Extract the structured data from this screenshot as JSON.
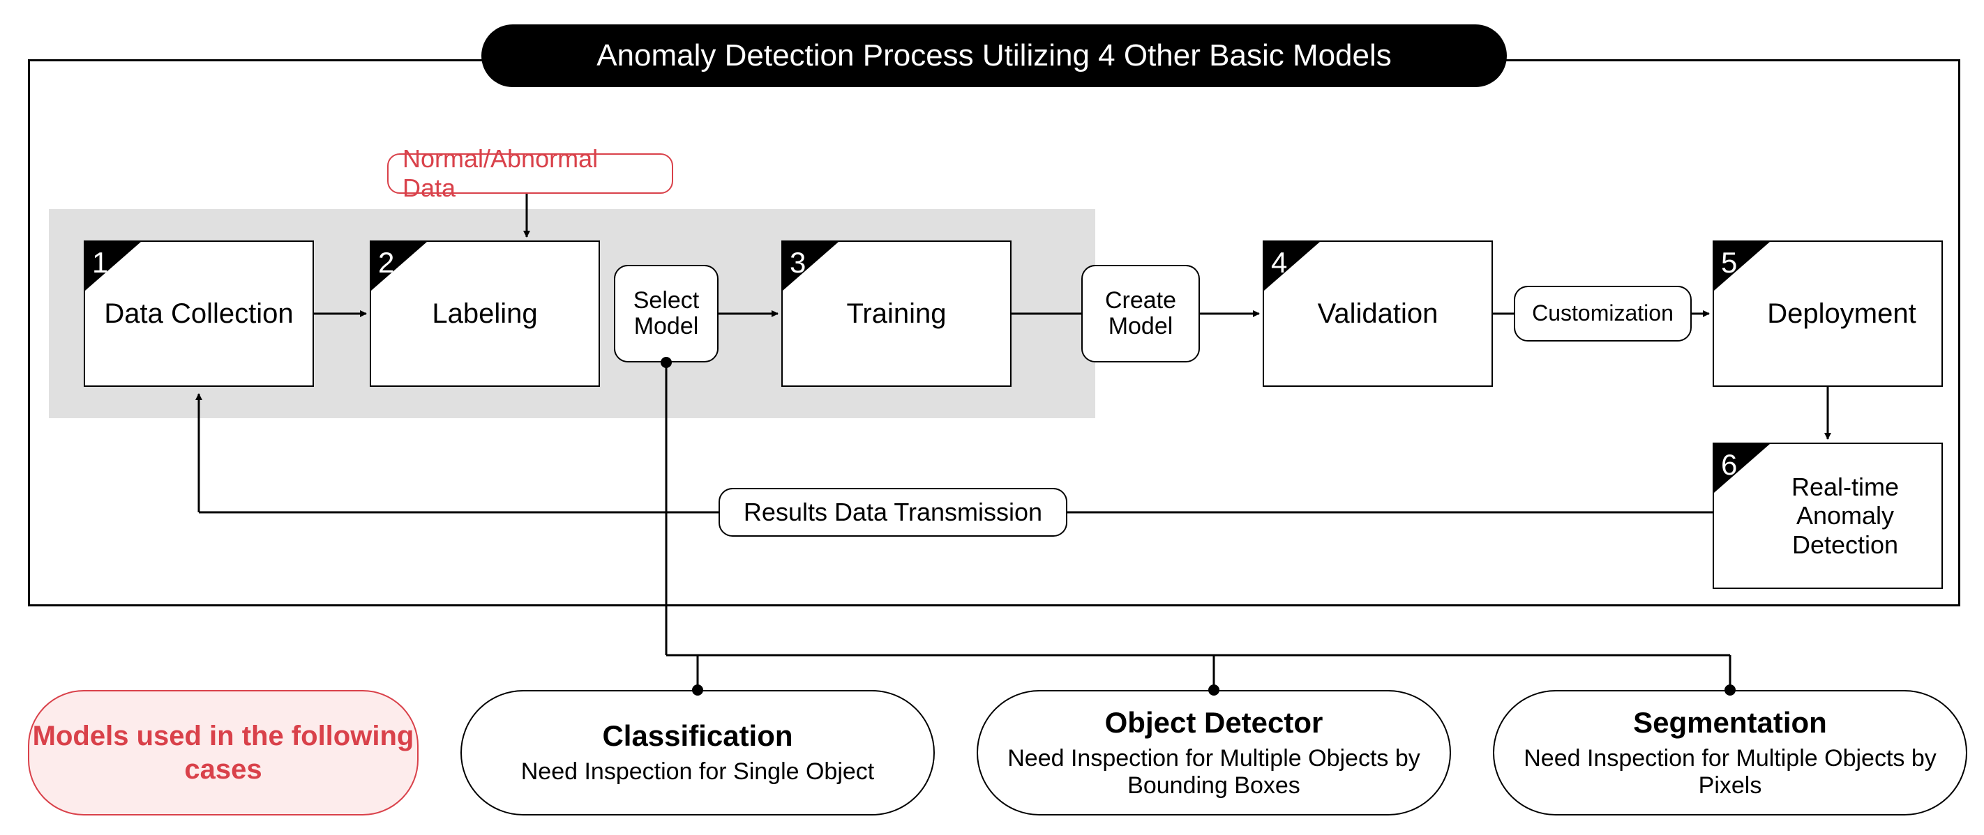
{
  "title": "Anomaly Detection Process Utilizing 4 Other Basic Models",
  "annot": "Normal/Abnormal Data",
  "steps": {
    "s1": "Data Collection",
    "s2": "Labeling",
    "s3": "Training",
    "s4": "Validation",
    "s5": "Deployment",
    "s6": "Real-time Anomaly Detection"
  },
  "nums": {
    "n1": "1",
    "n2": "2",
    "n3": "3",
    "n4": "4",
    "n5": "5",
    "n6": "6"
  },
  "small": {
    "select": "Select Model",
    "create": "Create Model",
    "custom": "Customization",
    "results": "Results Data Transmission"
  },
  "redpill": "Models used in the following cases",
  "models": {
    "m1t": "Classification",
    "m1s": "Need Inspection for Single Object",
    "m2t": "Object Detector",
    "m2s": "Need Inspection for Multiple Objects by Bounding Boxes",
    "m3t": "Segmentation",
    "m3s": "Need Inspection for Multiple Objects by Pixels"
  }
}
